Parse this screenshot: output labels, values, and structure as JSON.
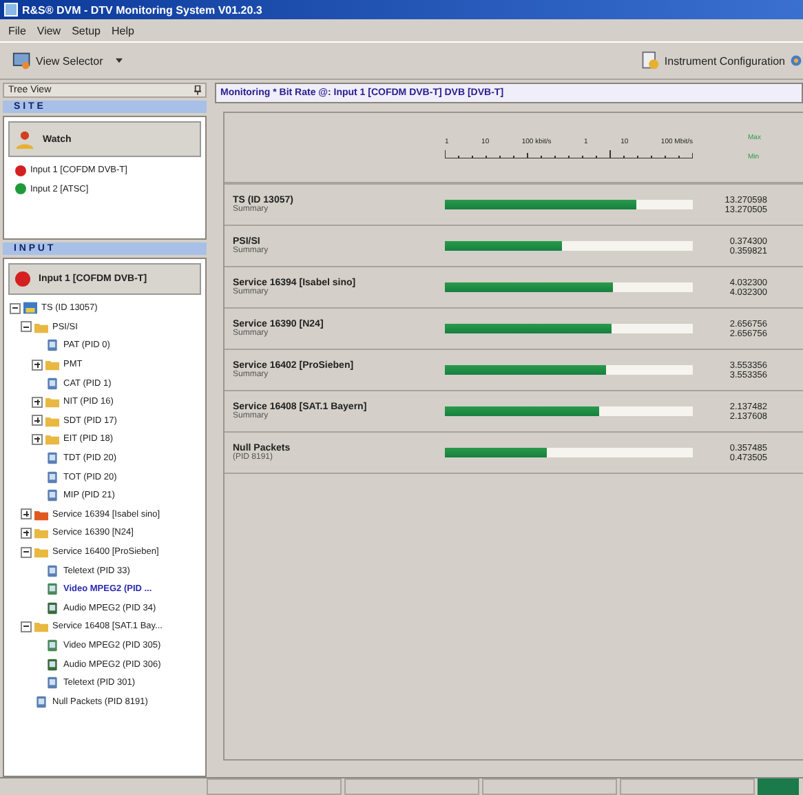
{
  "window": {
    "title": "R&S® DVM - DTV Monitoring System V01.20.3"
  },
  "menu": [
    "File",
    "View",
    "Setup",
    "Help"
  ],
  "toolbar": {
    "view_selector": "View Selector",
    "instrument_config": "Instrument Configuration"
  },
  "tree_view": {
    "title": "Tree View",
    "site_label": "S I T E",
    "watch": {
      "title": "Watch",
      "items": [
        {
          "label": "Input 1 [COFDM DVB-T]",
          "color": "#d42020"
        },
        {
          "label": "Input 2 [ATSC]",
          "color": "#1e9a3a"
        }
      ]
    },
    "input_label": "I N P U T",
    "input_title": "Input 1 [COFDM DVB-T]",
    "tree": [
      {
        "label": "TS (ID 13057)",
        "kind": "ts",
        "selected": false,
        "expanded": true,
        "children": [
          {
            "label": "PSI/SI",
            "kind": "folder",
            "selected": false,
            "expanded": true,
            "children": [
              {
                "label": "PAT (PID 0)",
                "kind": "table",
                "selected": false
              },
              {
                "label": "PMT",
                "kind": "folder",
                "selected": false,
                "expanded": false
              },
              {
                "label": "CAT (PID 1)",
                "kind": "table",
                "selected": false
              },
              {
                "label": "NIT (PID 16)",
                "kind": "folder",
                "selected": false,
                "expanded": false
              },
              {
                "label": "SDT (PID 17)",
                "kind": "folder",
                "selected": false,
                "expanded": false
              },
              {
                "label": "EIT (PID 18)",
                "kind": "folder",
                "selected": false,
                "expanded": false
              },
              {
                "label": "TDT (PID 20)",
                "kind": "table",
                "selected": false
              },
              {
                "label": "TOT (PID 20)",
                "kind": "table",
                "selected": false
              },
              {
                "label": "MIP (PID 21)",
                "kind": "table",
                "selected": false
              }
            ]
          },
          {
            "label": "Service 16394 [Isabel sino]",
            "kind": "folder-alert",
            "selected": false,
            "expanded": false
          },
          {
            "label": "Service 16390 [N24]",
            "kind": "folder",
            "selected": false,
            "expanded": false
          },
          {
            "label": "Service 16400 [ProSieben]",
            "kind": "folder",
            "selected": false,
            "expanded": true,
            "children": [
              {
                "label": "Teletext (PID 33)",
                "kind": "table",
                "selected": false
              },
              {
                "label": "Video MPEG2 (PID ...",
                "kind": "video",
                "selected": true
              },
              {
                "label": "Audio MPEG2 (PID 34)",
                "kind": "audio",
                "selected": false
              }
            ]
          },
          {
            "label": "Service 16408 [SAT.1 Bay...",
            "kind": "folder",
            "selected": false,
            "expanded": true,
            "children": [
              {
                "label": "Video MPEG2 (PID 305)",
                "kind": "video",
                "selected": false
              },
              {
                "label": "Audio MPEG2 (PID 306)",
                "kind": "audio",
                "selected": false
              },
              {
                "label": "Teletext (PID 301)",
                "kind": "table",
                "selected": false
              }
            ]
          },
          {
            "label": "Null Packets (PID 8191)",
            "kind": "table",
            "selected": false
          }
        ]
      }
    ]
  },
  "monitor": {
    "title": "Monitoring * Bit Rate @: Input 1 [COFDM DVB-T] DVB [DVB-T]",
    "scale_labels": [
      "1",
      "10",
      "100 kbit/s",
      "1",
      "10",
      "100 Mbit/s"
    ],
    "legend": [
      "Max",
      "Min"
    ],
    "rows": [
      {
        "name": "TS (ID 13057)",
        "sub": "Summary",
        "level": 0.77,
        "value_1": "13.270598",
        "value_2": "13.270505"
      },
      {
        "name": "PSI/SI",
        "sub": "Summary",
        "level": 0.47,
        "value_1": "0.374300",
        "value_2": "0.359821"
      },
      {
        "name": "Service 16394 [Isabel sino]",
        "sub": "Summary",
        "level": 0.68,
        "value_1": "4.032300",
        "value_2": "4.032300"
      },
      {
        "name": "Service 16390 [N24]",
        "sub": "Summary",
        "level": 0.67,
        "value_1": "2.656756",
        "value_2": "2.656756"
      },
      {
        "name": "Service 16402 [ProSieben]",
        "sub": "Summary",
        "level": 0.65,
        "value_1": "3.553356",
        "value_2": "3.553356"
      },
      {
        "name": "Service 16408 [SAT.1 Bayern]",
        "sub": "Summary",
        "level": 0.62,
        "value_1": "2.137482",
        "value_2": "2.137608"
      },
      {
        "name": "Null Packets",
        "sub": "(PID 8191)",
        "level": 0.41,
        "value_1": "0.357485",
        "value_2": "0.473505"
      }
    ]
  }
}
